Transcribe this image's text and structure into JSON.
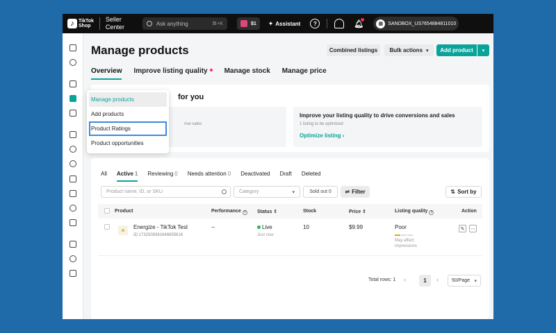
{
  "topbar": {
    "brand_line1": "TikTok",
    "brand_line2": "Shop",
    "center_line1": "Seller",
    "center_line2": "Center",
    "search_placeholder": "Ask anything",
    "search_shortcut": "⌘+K",
    "gift_amount": "$1",
    "assistant_label": "Assistant",
    "account_name": "SANDBOX_US7654884811010"
  },
  "header": {
    "title": "Manage products",
    "combined_listings": "Combined listings",
    "bulk_actions": "Bulk actions",
    "add_product": "Add product"
  },
  "tabs": [
    {
      "label": "Overview"
    },
    {
      "label": "Improve listing quality"
    },
    {
      "label": "Manage stock"
    },
    {
      "label": "Manage price"
    }
  ],
  "recommendations": {
    "title_partial": "for you",
    "left_partial": "rive sales",
    "right_title": "Improve your listing quality to drive conversions and sales",
    "right_sub": "1 listing to be optimized",
    "right_link": "Optimize listing"
  },
  "menu": {
    "items": [
      "Manage products",
      "Add products",
      "Product Ratings",
      "Product opportunities"
    ]
  },
  "status_tabs": [
    {
      "label": "All",
      "count": ""
    },
    {
      "label": "Active",
      "count": "1"
    },
    {
      "label": "Reviewing",
      "count": "0"
    },
    {
      "label": "Needs attention",
      "count": "0"
    },
    {
      "label": "Deactivated",
      "count": ""
    },
    {
      "label": "Draft",
      "count": ""
    },
    {
      "label": "Deleted",
      "count": ""
    }
  ],
  "filters": {
    "search_placeholder": "Product name, ID, or SKU",
    "category_placeholder": "Category",
    "sold_out": "Sold out 0",
    "filter": "Filter",
    "sort": "Sort by"
  },
  "table": {
    "headers": {
      "product": "Product",
      "performance": "Performance",
      "status": "Status",
      "stock": "Stock",
      "price": "Price",
      "quality": "Listing quality",
      "action": "Action"
    },
    "rows": [
      {
        "name": "Energize - TikTok Test",
        "id": "ID:1732508381646655616",
        "performance": "--",
        "status": "Live",
        "status_sub": "Just now",
        "stock": "10",
        "price": "$9.99",
        "quality": "Poor",
        "quality_note_1": "May affect",
        "quality_note_2": "impressions",
        "quality_level": 0.33
      }
    ]
  },
  "pagination": {
    "total": "Total rows: 1",
    "page": "1",
    "page_size": "50/Page"
  },
  "colors": {
    "accent": "#0aa39a",
    "topbar": "#0f0f0f",
    "live": "#1db954",
    "alert": "#fe2c55"
  }
}
